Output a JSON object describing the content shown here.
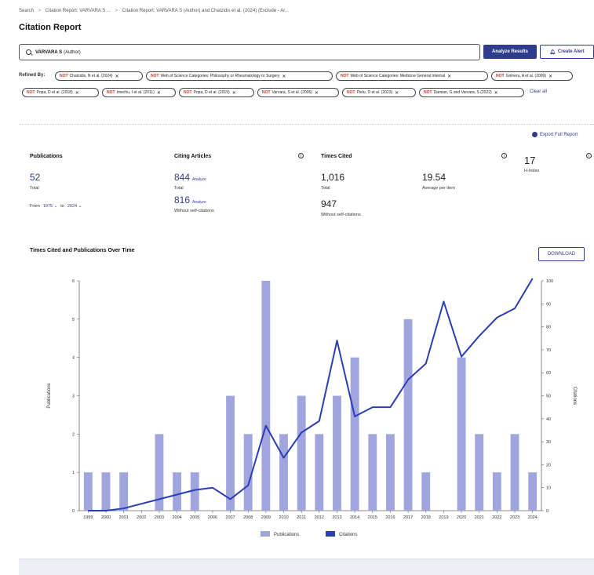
{
  "breadcrumb": {
    "items": [
      "Search",
      "Citation Report: VARVARA S ...",
      "Citation Report: VARVARA S (Author) and Chatzidis et al. (2024) (Exclude - Ar..."
    ],
    "separator": ">"
  },
  "page_title": "Citation Report",
  "search": {
    "value_bold": "VARVARA S",
    "value_rest": "(Author)"
  },
  "buttons": {
    "analyze": "Analyze Results",
    "create_alert": "Create Alert",
    "download": "DOWNLOAD",
    "export": "Export Full Report",
    "clear_all": "Clear all"
  },
  "refined": {
    "label": "Refined By:",
    "not_label": "NOT",
    "chips": [
      "Chatzidis, N et al. (2024)",
      "Web of Science Categories: Philosophy or Rheumatology or Surgery",
      "Web of Science Categories: Medicine General Internal",
      "Golneru, A et al. (2009)",
      "Popa, D et al. (2018)",
      "Imechu, I et al. (2011)",
      "Popa, D et al. (2019)",
      "Varvara, S et al. (2006)",
      "Pielu, D et al. (2023)",
      "Damian, G and Varvara, S (2022)"
    ]
  },
  "metrics": {
    "publications": {
      "title": "Publications",
      "value": "52",
      "label": "Total",
      "from_label": "From",
      "from_value": "1975",
      "to_label": "to",
      "to_value": "2024"
    },
    "citing": {
      "title": "Citing Articles",
      "total": "844",
      "total_label": "Total",
      "without": "816",
      "without_label": "Without self-citations",
      "analyze": "Analyze"
    },
    "times_cited": {
      "title": "Times Cited",
      "total": "1,016",
      "total_label": "Total",
      "avg": "19.54",
      "avg_label": "Average per item",
      "without": "947",
      "without_label": "Without self-citations"
    },
    "hindex": {
      "value": "17",
      "label": "H-Index"
    }
  },
  "chart_data": {
    "title": "Times Cited and Publications Over Time",
    "type": "bar",
    "categories": [
      "1999",
      "2000",
      "2001",
      "2002",
      "2003",
      "2004",
      "2005",
      "2006",
      "2007",
      "2008",
      "2009",
      "2010",
      "2011",
      "2012",
      "2013",
      "2014",
      "2015",
      "2016",
      "2017",
      "2018",
      "2019",
      "2020",
      "2021",
      "2022",
      "2023",
      "2024"
    ],
    "series": [
      {
        "name": "Publications",
        "type": "bar",
        "axis": "left",
        "values": [
          1,
          1,
          1,
          0,
          2,
          1,
          1,
          0,
          3,
          2,
          6,
          2,
          3,
          2,
          3,
          4,
          2,
          2,
          5,
          1,
          0,
          4,
          2,
          1,
          2,
          1
        ]
      },
      {
        "name": "Citations",
        "type": "line",
        "axis": "right",
        "values": [
          0,
          0,
          1,
          3,
          5,
          7,
          9,
          10,
          5,
          11,
          37,
          23,
          34,
          39,
          74,
          41,
          45,
          45,
          57,
          64,
          91,
          67,
          76,
          84,
          88,
          101
        ]
      }
    ],
    "ylabel": "Publications",
    "y2label": "Citations",
    "ylim": [
      0,
      6
    ],
    "y2lim": [
      0,
      100
    ],
    "yticks": [
      "0",
      "1",
      "2",
      "3",
      "4",
      "5",
      "6"
    ],
    "y2ticks": [
      "0",
      "10",
      "20",
      "30",
      "40",
      "50",
      "60",
      "70",
      "80",
      "90",
      "100"
    ],
    "colors": {
      "bar": "#a0a6dd",
      "line": "#2a3db5"
    },
    "legend_position": "bottom-center"
  }
}
